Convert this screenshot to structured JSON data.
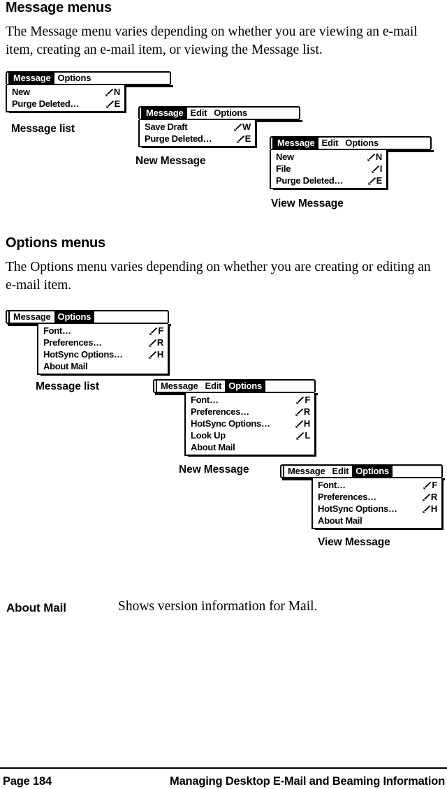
{
  "page": {
    "sections": [
      {
        "heading": "Message menus",
        "paragraph": "The Message menu varies depending on whether you are viewing an e-mail item, creating an e-mail item, or viewing the Message list."
      },
      {
        "heading": "Options menus",
        "paragraph": "The Options menu varies depending on whether you are creating or editing an e-mail item."
      }
    ]
  },
  "message_menus": [
    {
      "caption": "Message list",
      "menubar": [
        "Message",
        "Options"
      ],
      "selected": "Message",
      "items": [
        {
          "label": "New",
          "shortcut": "N",
          "stroke_icon": "graffiti-command-stroke-icon"
        },
        {
          "label": "Purge Deleted…",
          "shortcut": "E",
          "stroke_icon": "graffiti-command-stroke-icon"
        }
      ]
    },
    {
      "caption": "New Message",
      "menubar": [
        "Message",
        "Edit",
        "Options"
      ],
      "selected": "Message",
      "items": [
        {
          "label": "Save Draft",
          "shortcut": "W",
          "stroke_icon": "graffiti-command-stroke-icon"
        },
        {
          "label": "Purge Deleted…",
          "shortcut": "E",
          "stroke_icon": "graffiti-command-stroke-icon"
        }
      ]
    },
    {
      "caption": "View Message",
      "menubar": [
        "Message",
        "Edit",
        "Options"
      ],
      "selected": "Message",
      "items": [
        {
          "label": "New",
          "shortcut": "N",
          "stroke_icon": "graffiti-command-stroke-icon"
        },
        {
          "label": "File",
          "shortcut": "I",
          "stroke_icon": "graffiti-command-stroke-icon"
        },
        {
          "label": "Purge Deleted…",
          "shortcut": "E",
          "stroke_icon": "graffiti-command-stroke-icon"
        }
      ]
    }
  ],
  "options_menus": [
    {
      "caption": "Message list",
      "menubar": [
        "Message",
        "Options"
      ],
      "selected": "Options",
      "items": [
        {
          "label": "Font…",
          "shortcut": "F",
          "stroke_icon": "graffiti-command-stroke-icon"
        },
        {
          "label": "Preferences…",
          "shortcut": "R",
          "stroke_icon": "graffiti-command-stroke-icon"
        },
        {
          "label": "HotSync Options…",
          "shortcut": "H",
          "stroke_icon": "graffiti-command-stroke-icon"
        },
        {
          "label": "About Mail",
          "shortcut": "",
          "stroke_icon": ""
        }
      ]
    },
    {
      "caption": "New Message",
      "menubar": [
        "Message",
        "Edit",
        "Options"
      ],
      "selected": "Options",
      "items": [
        {
          "label": "Font…",
          "shortcut": "F",
          "stroke_icon": "graffiti-command-stroke-icon"
        },
        {
          "label": "Preferences…",
          "shortcut": "R",
          "stroke_icon": "graffiti-command-stroke-icon"
        },
        {
          "label": "HotSync Options…",
          "shortcut": "H",
          "stroke_icon": "graffiti-command-stroke-icon"
        },
        {
          "label": "Look Up",
          "shortcut": "L",
          "stroke_icon": "graffiti-command-stroke-icon"
        },
        {
          "label": "About Mail",
          "shortcut": "",
          "stroke_icon": ""
        }
      ]
    },
    {
      "caption": "View Message",
      "menubar": [
        "Message",
        "Edit",
        "Options"
      ],
      "selected": "Options",
      "items": [
        {
          "label": "Font…",
          "shortcut": "F",
          "stroke_icon": "graffiti-command-stroke-icon"
        },
        {
          "label": "Preferences…",
          "shortcut": "R",
          "stroke_icon": "graffiti-command-stroke-icon"
        },
        {
          "label": "HotSync Options…",
          "shortcut": "H",
          "stroke_icon": "graffiti-command-stroke-icon"
        },
        {
          "label": "About Mail",
          "shortcut": "",
          "stroke_icon": ""
        }
      ]
    }
  ],
  "definition": {
    "term": "About Mail",
    "description": "Shows version information for Mail."
  },
  "footer": {
    "page_label": "Page 184",
    "section_title": "Managing Desktop E-Mail and Beaming Information"
  },
  "colors": {
    "ink": "#000000",
    "paper": "#ffffff",
    "menu_selected_bg": "#000000",
    "menu_selected_fg": "#ffffff"
  }
}
